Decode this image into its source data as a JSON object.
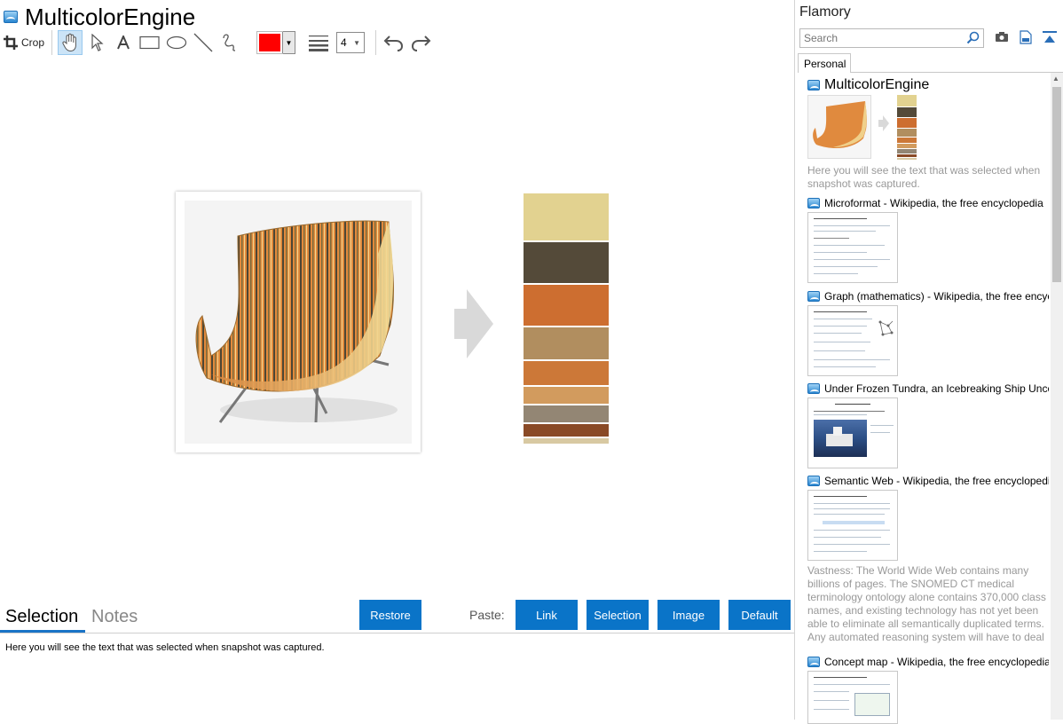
{
  "app": {
    "title": "MulticolorEngine"
  },
  "toolbar": {
    "crop_label": "Crop",
    "line_width": "4",
    "stroke_color": "#ff0000",
    "tools": [
      "crop-icon",
      "hand-icon",
      "pointer-icon",
      "text-icon",
      "rectangle-icon",
      "ellipse-icon",
      "line-icon",
      "freehand-icon",
      "line-width-icon",
      "undo-icon",
      "redo-icon"
    ]
  },
  "canvas": {
    "palette_colors": [
      "#e2d290",
      "#544a39",
      "#cd6e30",
      "#b18e5f",
      "#cc7838",
      "#d29b5e",
      "#938674",
      "#8a4a26",
      "#d8c9a2"
    ],
    "palette_weights": [
      53,
      46,
      46,
      36,
      27,
      19,
      19,
      14,
      6
    ]
  },
  "bottom": {
    "tabs": [
      "Selection",
      "Notes"
    ],
    "restore_label": "Restore",
    "paste_label": "Paste:",
    "link_label": "Link",
    "selection_label": "Selection",
    "image_label": "Image",
    "default_label": "Default",
    "selection_text": "Here you will see the text that was selected when snapshot was captured."
  },
  "sidebar": {
    "title": "Flamory",
    "search_placeholder": "Search",
    "tab_label": "Personal",
    "entries": [
      {
        "title": "MulticolorEngine",
        "desc": "Here you will see the text that was selected when snapshot was captured."
      },
      {
        "title": "Microformat - Wikipedia, the free encyclopedia"
      },
      {
        "title": "Graph (mathematics) - Wikipedia, the free encyclopedia"
      },
      {
        "title": "Under Frozen Tundra, an Icebreaking Ship Uncovers"
      },
      {
        "title": "Semantic Web - Wikipedia, the free encyclopedia",
        "desc": "Vastness: The World Wide Web contains many billions of pages. The SNOMED CT medical terminology ontology alone contains 370,000 class names, and existing technology has not yet been able to eliminate all semantically duplicated terms. Any automated reasoning system will have to deal with truly huge inputs."
      },
      {
        "title": "Concept map - Wikipedia, the free encyclopedia"
      }
    ]
  }
}
